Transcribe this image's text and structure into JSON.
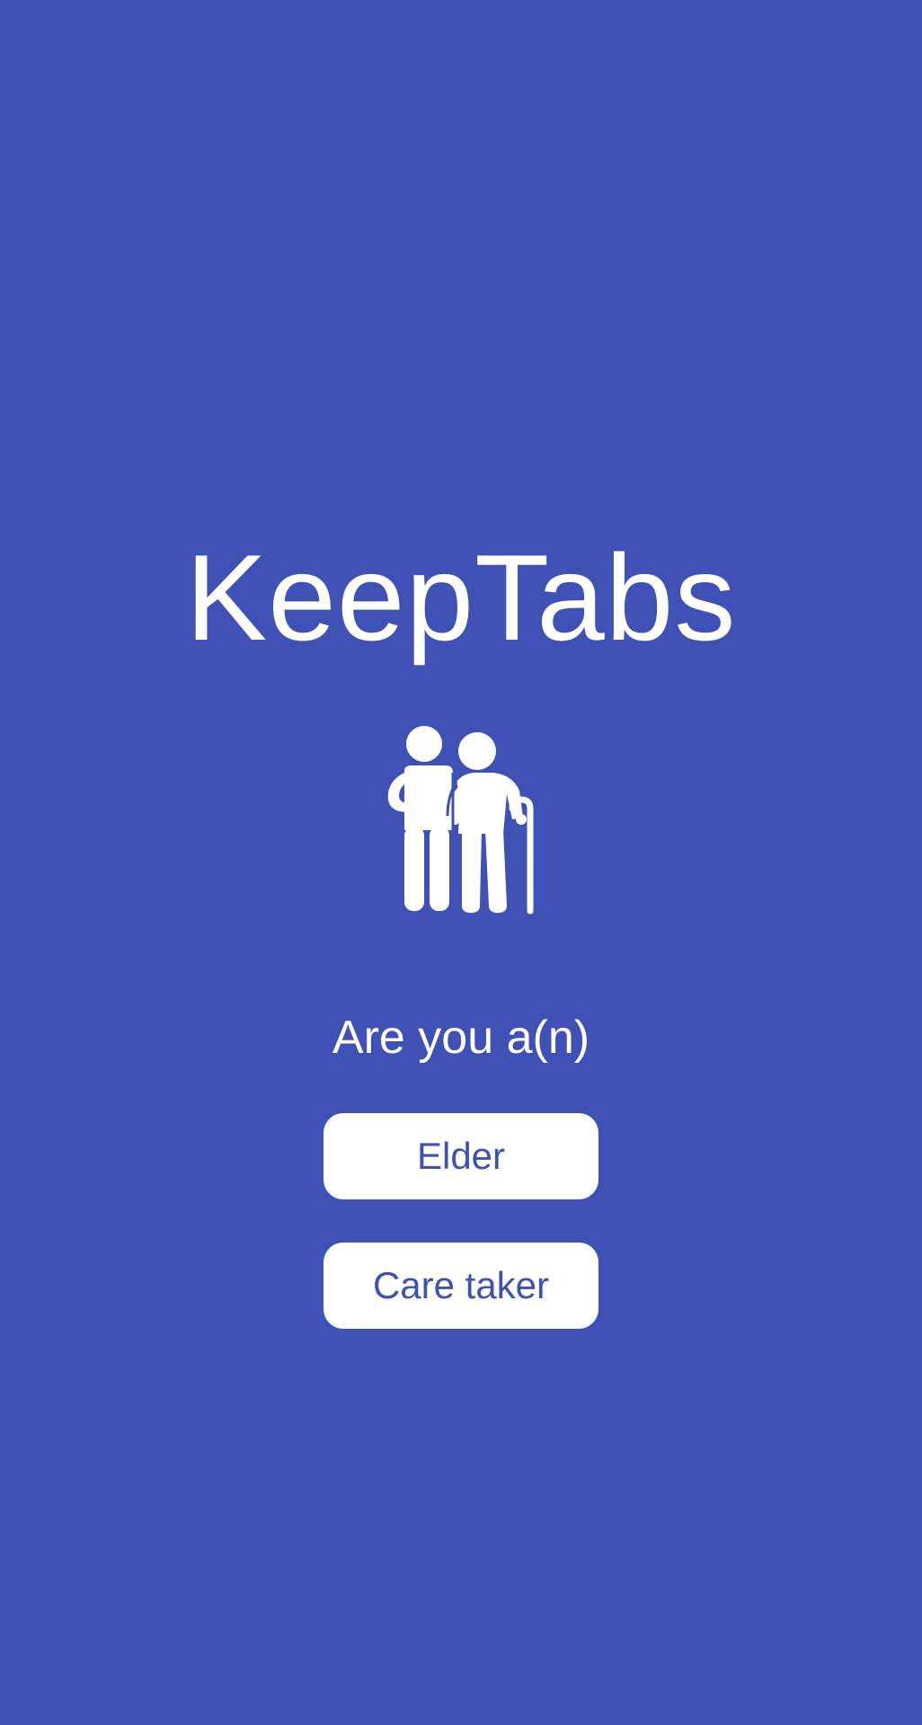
{
  "app": {
    "title": "KeepTabs",
    "logo_icon": "elder-with-caretaker-icon"
  },
  "question": {
    "prompt": "Are you a(n)"
  },
  "roles": {
    "elder_label": "Elder",
    "caretaker_label": "Care taker"
  },
  "colors": {
    "background": "#3F51B5",
    "foreground": "#FFFFFF",
    "button_text": "#3F51B5"
  }
}
